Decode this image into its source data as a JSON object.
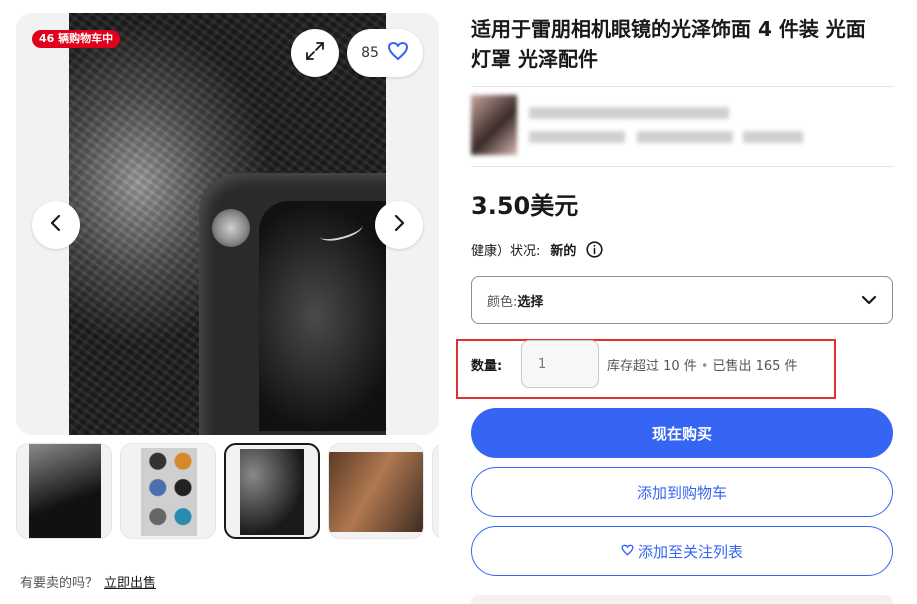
{
  "gallery": {
    "cart_badge": "46 辆购物车中",
    "favorite_count": "85",
    "expand_icon": "expand-icon",
    "favorite_icon": "heart-outline-icon",
    "prev_icon": "chevron-left-icon",
    "next_icon": "chevron-right-icon",
    "thumbnails": [
      "thumb-1",
      "thumb-2",
      "thumb-3",
      "thumb-4",
      "thumb-5"
    ],
    "selected_thumbnail_index": 2
  },
  "sell": {
    "prompt": "有要卖的吗？",
    "link": "立即出售"
  },
  "product": {
    "title": "适用于雷朋相机眼镜的光泽饰面 4 件装 光面 灯罩 光泽配件",
    "price": "3.50美元",
    "condition_label": "健康）状况:",
    "condition_value": "新的",
    "variation": {
      "label": "颜色: ",
      "value": "选择"
    },
    "quantity": {
      "label": "数量:",
      "placeholder": "1",
      "available": "库存超过 10 件",
      "separator": "•",
      "sold": "已售出 165 件"
    }
  },
  "actions": {
    "buy_now": "现在购买",
    "add_to_cart": "添加到购物车",
    "add_to_watchlist": "添加至关注列表"
  },
  "colors": {
    "accent": "#3665f3",
    "badge": "#e0001b",
    "highlight": "#e03030"
  }
}
